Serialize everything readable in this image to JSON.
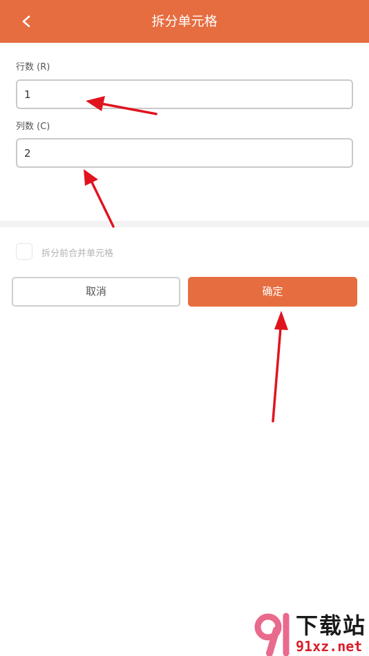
{
  "header": {
    "title": "拆分单元格",
    "back_icon": "chevron-left-icon",
    "background_color": "#E66D40"
  },
  "form": {
    "rows": {
      "label": "行数 (R)",
      "value": "1"
    },
    "columns": {
      "label": "列数 (C)",
      "value": "2"
    },
    "merge_before_split": {
      "label": "拆分前合并单元格",
      "checked": false
    }
  },
  "buttons": {
    "cancel_label": "取消",
    "ok_label": "确定"
  },
  "annotations": {
    "arrow_color": "#e0141e"
  },
  "watermark": {
    "title": "下载站",
    "url": "91xz.net"
  }
}
